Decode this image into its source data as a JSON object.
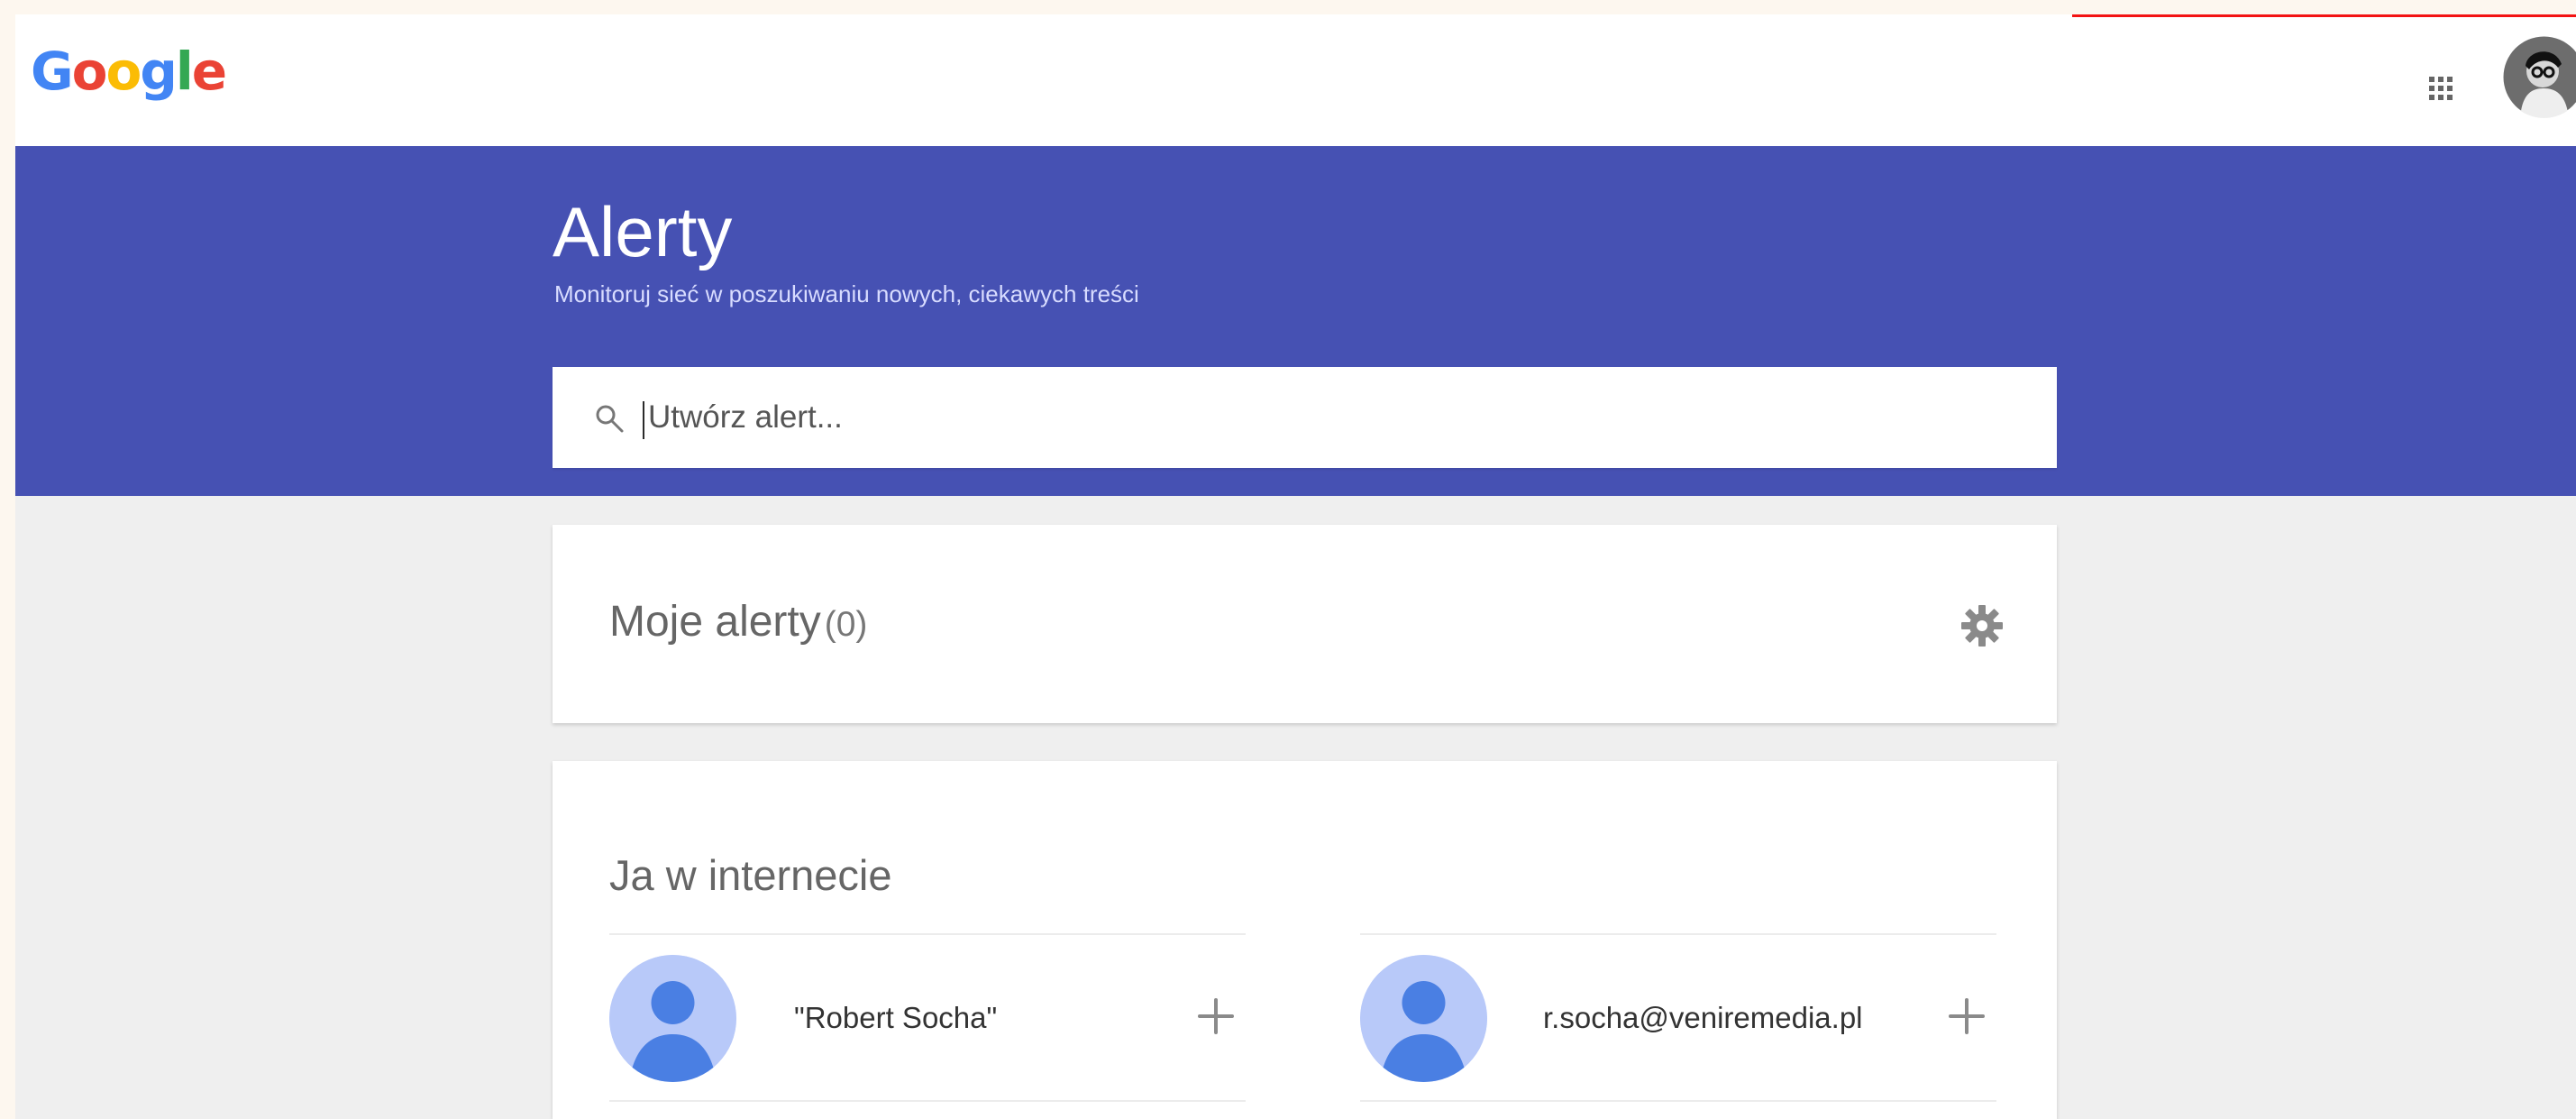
{
  "topbar": {
    "logo": {
      "text": "Google",
      "letters": [
        {
          "char": "G",
          "color": "#4285f4"
        },
        {
          "char": "o",
          "color": "#ea4335"
        },
        {
          "char": "o",
          "color": "#fbbc05"
        },
        {
          "char": "g",
          "color": "#4285f4"
        },
        {
          "char": "l",
          "color": "#34a853"
        },
        {
          "char": "e",
          "color": "#ea4335"
        }
      ]
    },
    "apps_icon": "apps-grid-icon",
    "avatar_icon": "profile-avatar-icon"
  },
  "hero": {
    "title": "Alerty",
    "subtitle": "Monitoruj sieć w poszukiwaniu nowych, ciekawych treści",
    "background_color": "#4651b3"
  },
  "search": {
    "placeholder": "Utwórz alert...",
    "value": "",
    "icon": "search-icon"
  },
  "my_alerts": {
    "title": "Moje alerty",
    "count": "(0)",
    "settings_icon": "gear-icon"
  },
  "web_presence": {
    "title": "Ja w internecie",
    "suggestions": [
      {
        "label": "\"Robert Socha\"",
        "avatar_icon": "person-avatar-icon",
        "add_icon": "plus-icon"
      },
      {
        "label": "r.socha@veniremedia.pl",
        "avatar_icon": "person-avatar-icon",
        "add_icon": "plus-icon"
      }
    ]
  },
  "colors": {
    "accent": "#4651b3",
    "top_accent": "#f31313",
    "page_background": "#efefef",
    "card_background": "#ffffff"
  }
}
